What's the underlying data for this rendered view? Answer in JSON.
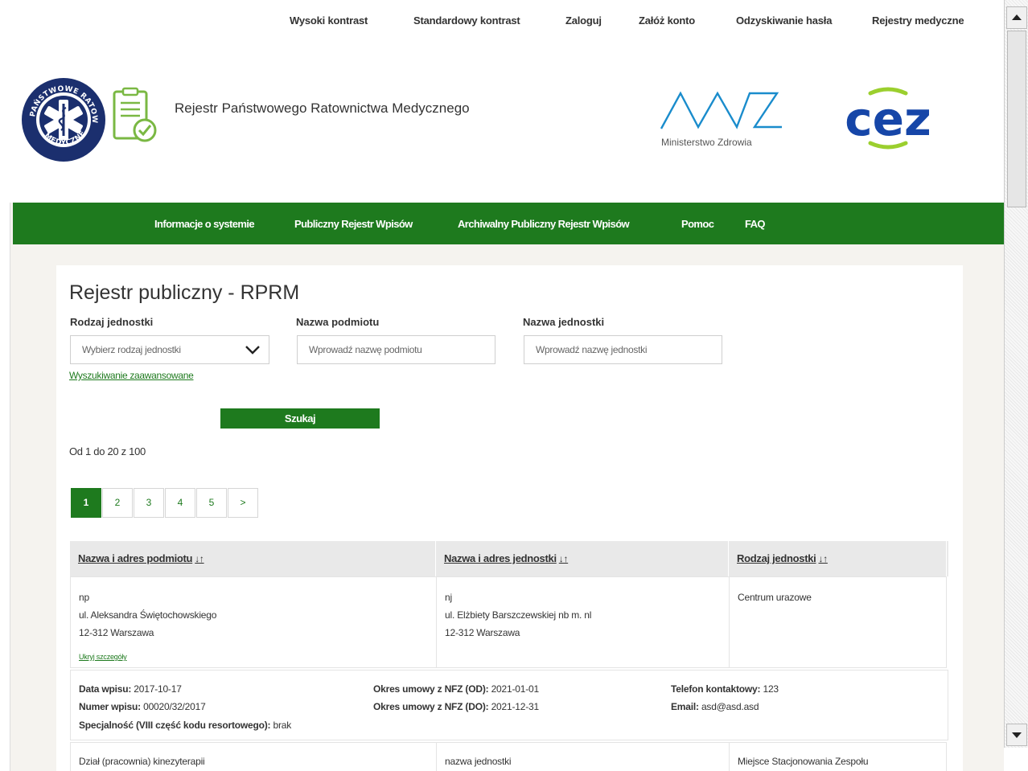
{
  "top_links": [
    "Wysoki kontrast",
    "Standardowy kontrast",
    "Zaloguj",
    "Załóż konto",
    "Odzyskiwanie hasła",
    "Rejestry medyczne"
  ],
  "header": {
    "site_title": "Rejestr Państwowego Ratownictwa Medycznego",
    "mz_caption": "Ministerstwo Zdrowia",
    "cez_text": "cez"
  },
  "nav": [
    "Informacje o systemie",
    "Publiczny Rejestr Wpisów",
    "Archiwalny Publiczny Rejestr Wpisów",
    "Pomoc",
    "FAQ"
  ],
  "main": {
    "title": "Rejestr publiczny - RPRM",
    "filters": {
      "type_label": "Rodzaj jednostki",
      "type_value": "Wybierz rodzaj jednostki",
      "entity_label": "Nazwa podmiotu",
      "entity_placeholder": "Wprowadź nazwę podmiotu",
      "unit_label": "Nazwa jednostki",
      "unit_placeholder": "Wprowadź nazwę jednostki"
    },
    "advanced_link": "Wyszukiwanie zaawansowane",
    "search_button": "Szukaj",
    "range_text": "Od 1 do 20 z 100",
    "pages": [
      "1",
      "2",
      "3",
      "4",
      "5",
      ">"
    ],
    "active_page": "1"
  },
  "table": {
    "headers": [
      "Nazwa i adres podmiotu",
      "Nazwa i adres jednostki",
      "Rodzaj jednostki"
    ],
    "sort_glyph": "↓↑",
    "row1": {
      "entity_name": "np",
      "entity_street": "ul. Aleksandra Świętochowskiego",
      "entity_city": "12-312 Warszawa",
      "details_link": "Ukryj szczegóły",
      "unit_name": "nj",
      "unit_street": "ul. Elżbiety Barszczewskiej nb m. nl",
      "unit_city": "12-312 Warszawa",
      "unit_type": "Centrum urazowe"
    },
    "details": {
      "date_label": "Data wpisu:",
      "date_value": "2017-10-17",
      "number_label": "Numer wpisu:",
      "number_value": "00020/32/2017",
      "spec_label": "Specjalność (VIII część kodu resortowego):",
      "spec_value": "brak",
      "nfz_od_label": "Okres umowy z NFZ (OD):",
      "nfz_od_value": "2021-01-01",
      "nfz_do_label": "Okres umowy z NFZ (DO):",
      "nfz_do_value": "2021-12-31",
      "phone_label": "Telefon kontaktowy:",
      "phone_value": "123",
      "email_label": "Email:",
      "email_value": "asd@asd.asd"
    },
    "row2": [
      "Dział (pracownia) kinezyterapii",
      "nazwa jednostki",
      "Miejsce Stacjonowania Zespołu"
    ]
  },
  "colors": {
    "brand_green": "#1e7a1e",
    "mz_blue": "#1a8ccc",
    "cez_blue": "#1646a8",
    "cez_green": "#9bcf2e"
  }
}
